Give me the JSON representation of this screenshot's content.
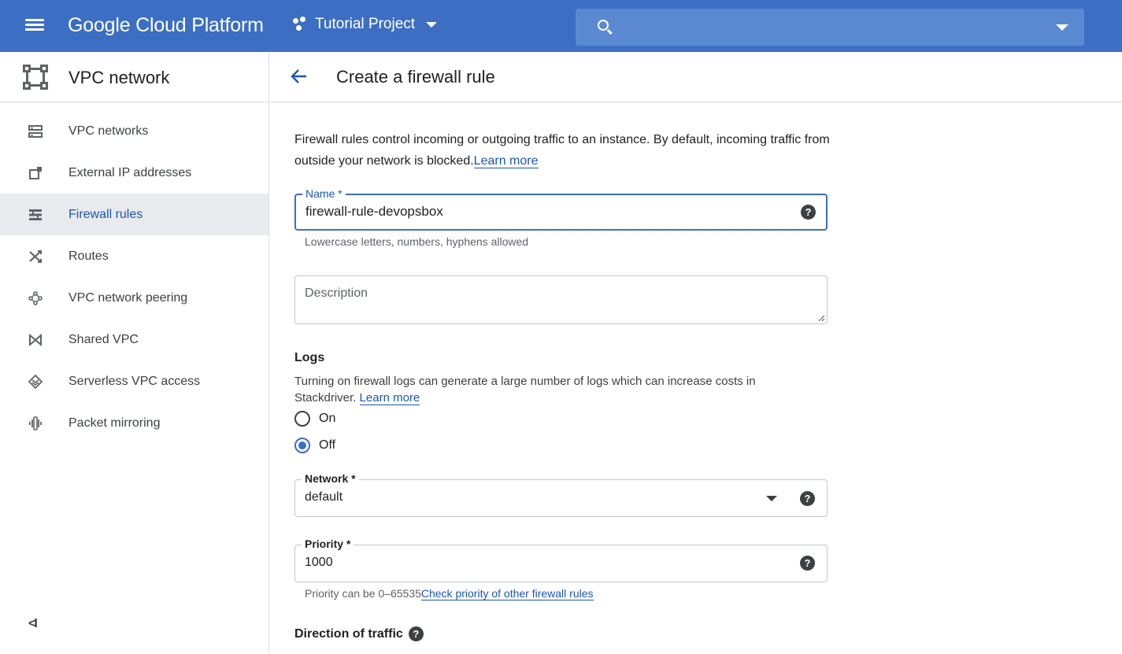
{
  "topbar": {
    "brand": "Google Cloud Platform",
    "project": "Tutorial Project",
    "search_placeholder": ""
  },
  "sidebar": {
    "title": "VPC network",
    "items": [
      {
        "label": "VPC networks",
        "icon": "vpc-networks-icon"
      },
      {
        "label": "External IP addresses",
        "icon": "external-ip-icon"
      },
      {
        "label": "Firewall rules",
        "icon": "firewall-icon",
        "active": true
      },
      {
        "label": "Routes",
        "icon": "routes-icon"
      },
      {
        "label": "VPC network peering",
        "icon": "peering-icon"
      },
      {
        "label": "Shared VPC",
        "icon": "shared-vpc-icon"
      },
      {
        "label": "Serverless VPC access",
        "icon": "serverless-icon"
      },
      {
        "label": "Packet mirroring",
        "icon": "packet-mirroring-icon"
      }
    ],
    "collapse_label": "<I"
  },
  "main": {
    "page_title": "Create a firewall rule",
    "intro_text": "Firewall rules control incoming or outgoing traffic to an instance. By default, incoming traffic from outside your network is blocked.",
    "intro_link": "Learn more",
    "name_field": {
      "label": "Name *",
      "value": "firewall-rule-devopsbox",
      "hint": "Lowercase letters, numbers, hyphens allowed"
    },
    "description_field": {
      "placeholder": "Description"
    },
    "logs": {
      "title": "Logs",
      "description": "Turning on firewall logs can generate a large number of logs which can increase costs in Stackdriver.",
      "link": "Learn more",
      "option_on": "On",
      "option_off": "Off",
      "selected": "Off"
    },
    "network_field": {
      "label": "Network *",
      "value": "default"
    },
    "priority_field": {
      "label": "Priority *",
      "value": "1000",
      "hint": "Priority can be 0–65535",
      "hint_link": "Check priority of other firewall rules"
    },
    "direction_title": "Direction of traffic"
  },
  "colors": {
    "topbar": "#3c6ec4",
    "search": "#5a89d2",
    "link": "#1a56b8",
    "active_bg": "#e8eaed"
  }
}
